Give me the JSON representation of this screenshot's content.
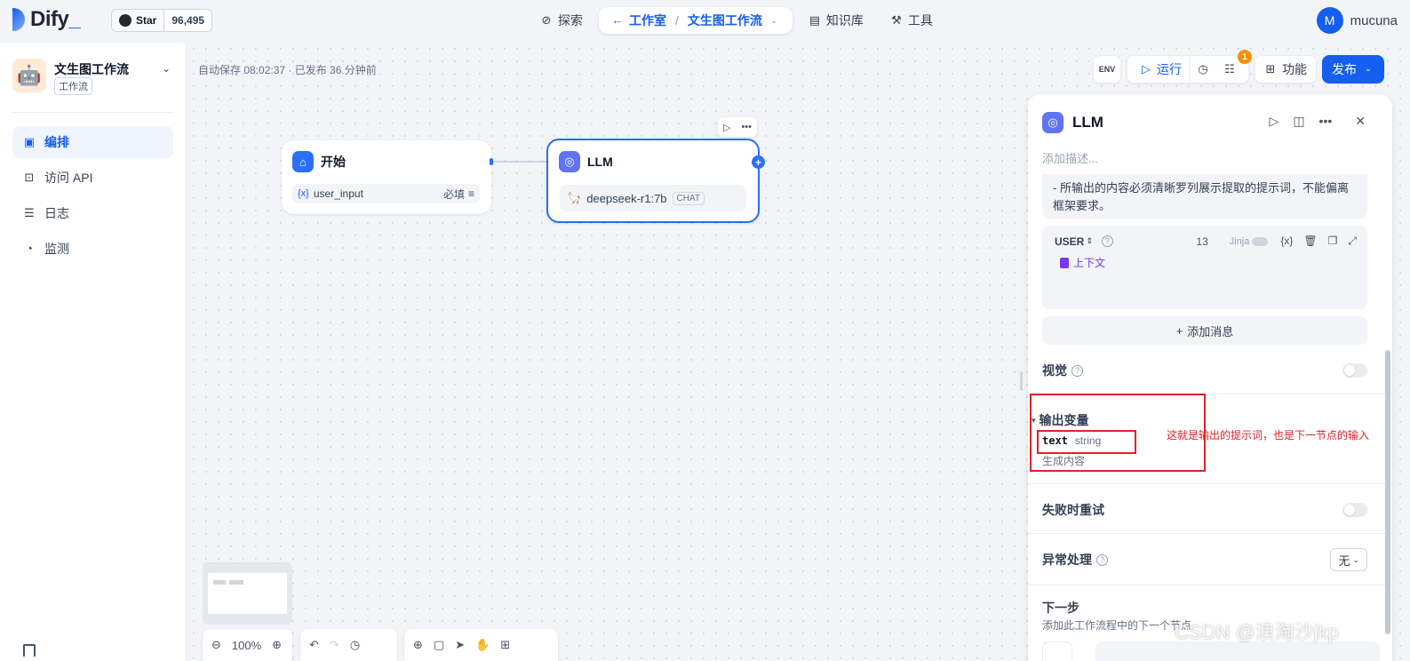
{
  "brand": {
    "name": "Dify",
    "accent": "#155eef"
  },
  "github": {
    "label": "Star",
    "count": "96,495"
  },
  "nav": {
    "explore": "探索",
    "studio": "工作室",
    "current_app": "文生图工作流",
    "knowledge": "知识库",
    "tools": "工具"
  },
  "user": {
    "initial": "M",
    "name": "mucuna"
  },
  "app": {
    "name": "文生图工作流",
    "tag": "工作流"
  },
  "sidebar": {
    "items": [
      {
        "label": "编排",
        "icon": "layout-icon"
      },
      {
        "label": "访问 API",
        "icon": "terminal-icon"
      },
      {
        "label": "日志",
        "icon": "file-text-icon"
      },
      {
        "label": "监测",
        "icon": "gauge-icon"
      }
    ]
  },
  "status": {
    "autosave": "自动保存 08:02:37 · 已发布 36 分钟前"
  },
  "toolbar": {
    "env": "ENV",
    "run": "运行",
    "checklist_badge": "1",
    "features": "功能",
    "publish": "发布"
  },
  "nodes": {
    "start": {
      "title": "开始",
      "var_name": "user_input",
      "var_required": "必填"
    },
    "llm": {
      "title": "LLM",
      "model": "deepseek-r1:7b",
      "mode": "CHAT"
    }
  },
  "canvas_controls": {
    "zoom": "100%"
  },
  "panel": {
    "title": "LLM",
    "desc_placeholder": "添加描述...",
    "prompt_tail": "- 所输出的内容必须清晰罗列展示提取的提示词，不能偏离框架要求。",
    "user_msg": {
      "role": "USER",
      "count": "13",
      "jinja": "Jinja",
      "context": "上下文"
    },
    "add_message": "添加消息",
    "vision": "视觉",
    "output_title": "输出变量",
    "output_var": {
      "name": "text",
      "type": "string",
      "desc": "生成内容"
    },
    "retry": "失败时重试",
    "error_handling": "异常处理",
    "error_value": "无",
    "next_step": "下一步",
    "next_desc": "添加此工作流程中的下一个节点"
  },
  "annotation": {
    "text": "这就是输出的提示词，也是下一节点的输入",
    "color": "#e5202a"
  },
  "watermark": "CSDN @浪淘沙jkp"
}
